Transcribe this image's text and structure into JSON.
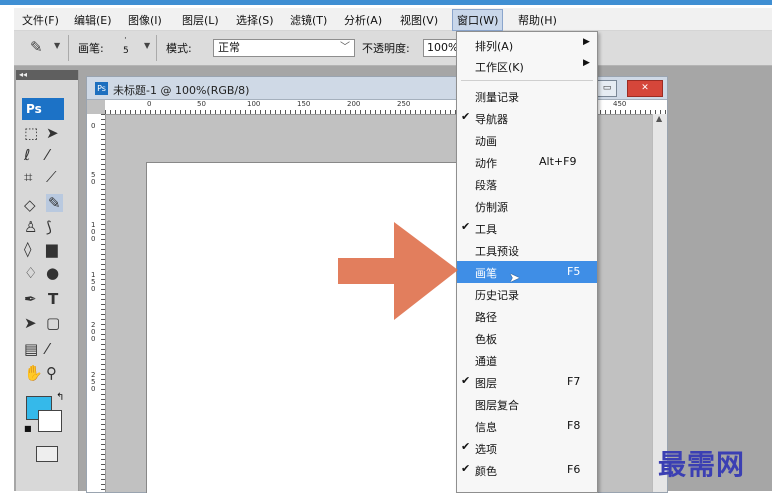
{
  "menubar": {
    "items": [
      {
        "label": "文件(F)"
      },
      {
        "label": "编辑(E)"
      },
      {
        "label": "图像(I)"
      },
      {
        "label": "图层(L)"
      },
      {
        "label": "选择(S)"
      },
      {
        "label": "滤镜(T)"
      },
      {
        "label": "分析(A)"
      },
      {
        "label": "视图(V)"
      },
      {
        "label": "窗口(W)"
      },
      {
        "label": "帮助(H)"
      }
    ]
  },
  "options_bar": {
    "brush_label": "画笔:",
    "brush_size": "5",
    "mode_label": "模式:",
    "mode_value": "正常",
    "opacity_label": "不透明度:",
    "opacity_value": "100%"
  },
  "toolbox": {
    "logo": "Ps",
    "collapse": "◂◂",
    "fg_color": "#35b9ea",
    "bg_color": "#ffffff"
  },
  "document": {
    "title": "未标题-1 @ 100%(RGB/8)",
    "icon_label": "Ps",
    "ruler_h": [
      "0",
      "50",
      "100",
      "150",
      "200",
      "250",
      "450"
    ],
    "ruler_v": [
      "0",
      "5\n0",
      "1\n0\n0",
      "1\n5\n0",
      "2\n0\n0",
      "2\n5\n0"
    ]
  },
  "window_menu": {
    "items": [
      {
        "label": "排列(A)",
        "submenu": true
      },
      {
        "label": "工作区(K)",
        "submenu": true
      },
      {
        "separator": true
      },
      {
        "label": "测量记录"
      },
      {
        "label": "导航器",
        "checked": true
      },
      {
        "label": "动画"
      },
      {
        "label": "动作",
        "shortcut": "Alt+F9"
      },
      {
        "label": "段落"
      },
      {
        "label": "仿制源"
      },
      {
        "label": "工具",
        "checked": true
      },
      {
        "label": "工具预设"
      },
      {
        "label": "画笔",
        "shortcut": "F5",
        "highlighted": true
      },
      {
        "label": "历史记录"
      },
      {
        "label": "路径"
      },
      {
        "label": "色板"
      },
      {
        "label": "通道"
      },
      {
        "label": "图层",
        "shortcut": "F7",
        "checked": true
      },
      {
        "label": "图层复合"
      },
      {
        "label": "信息",
        "shortcut": "F8"
      },
      {
        "label": "选项",
        "checked": true
      },
      {
        "label": "颜色",
        "shortcut": "F6",
        "checked": true
      }
    ]
  },
  "overlay": {
    "arrow_color": "#e0734f",
    "watermark": "最需网"
  },
  "colors": {
    "accent": "#3f8ee6",
    "title_bar": "#3f8fd3"
  }
}
